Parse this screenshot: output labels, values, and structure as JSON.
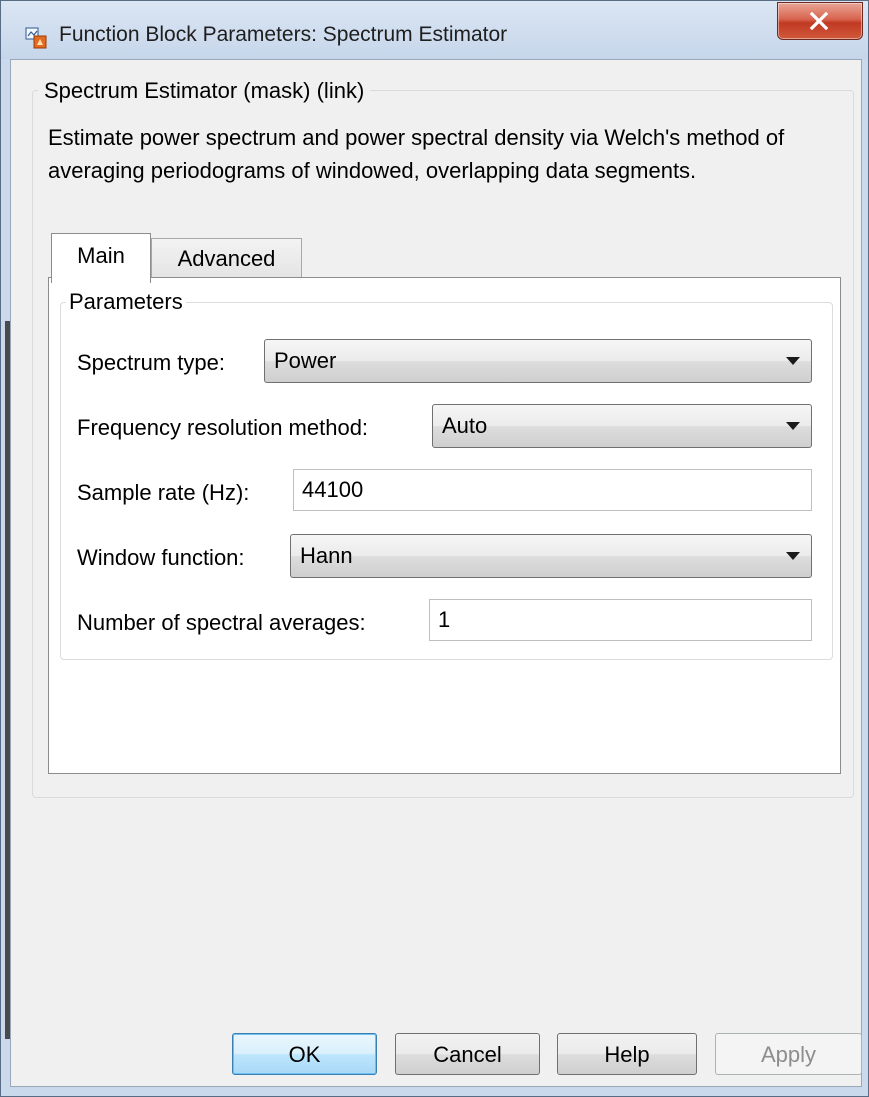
{
  "window": {
    "title": "Function Block Parameters: Spectrum Estimator",
    "close_glyph": "X",
    "app_icon": "simulink-block-icon"
  },
  "block": {
    "header": "Spectrum Estimator (mask) (link)",
    "description": "Estimate power spectrum and power spectral density via Welch's method of averaging periodograms of windowed, overlapping data segments."
  },
  "tabs": [
    {
      "label": "Main",
      "selected": true
    },
    {
      "label": "Advanced",
      "selected": false
    }
  ],
  "parameters": {
    "group_label": "Parameters",
    "spectrum_type": {
      "label": "Spectrum type:",
      "value": "Power"
    },
    "frequency_resolution_method": {
      "label": "Frequency resolution method:",
      "value": "Auto"
    },
    "sample_rate": {
      "label": "Sample rate (Hz):",
      "value": "44100"
    },
    "window_function": {
      "label": "Window function:",
      "value": "Hann"
    },
    "spectral_averages": {
      "label": "Number of spectral averages:",
      "value": "1"
    }
  },
  "buttons": {
    "ok": "OK",
    "cancel": "Cancel",
    "help": "Help",
    "apply": "Apply"
  },
  "colors": {
    "title_bar": "#c9d9ed",
    "close_button": "#c7432a",
    "default_button_border": "#3c7fb1",
    "disabled_text": "#8d8d8d"
  }
}
